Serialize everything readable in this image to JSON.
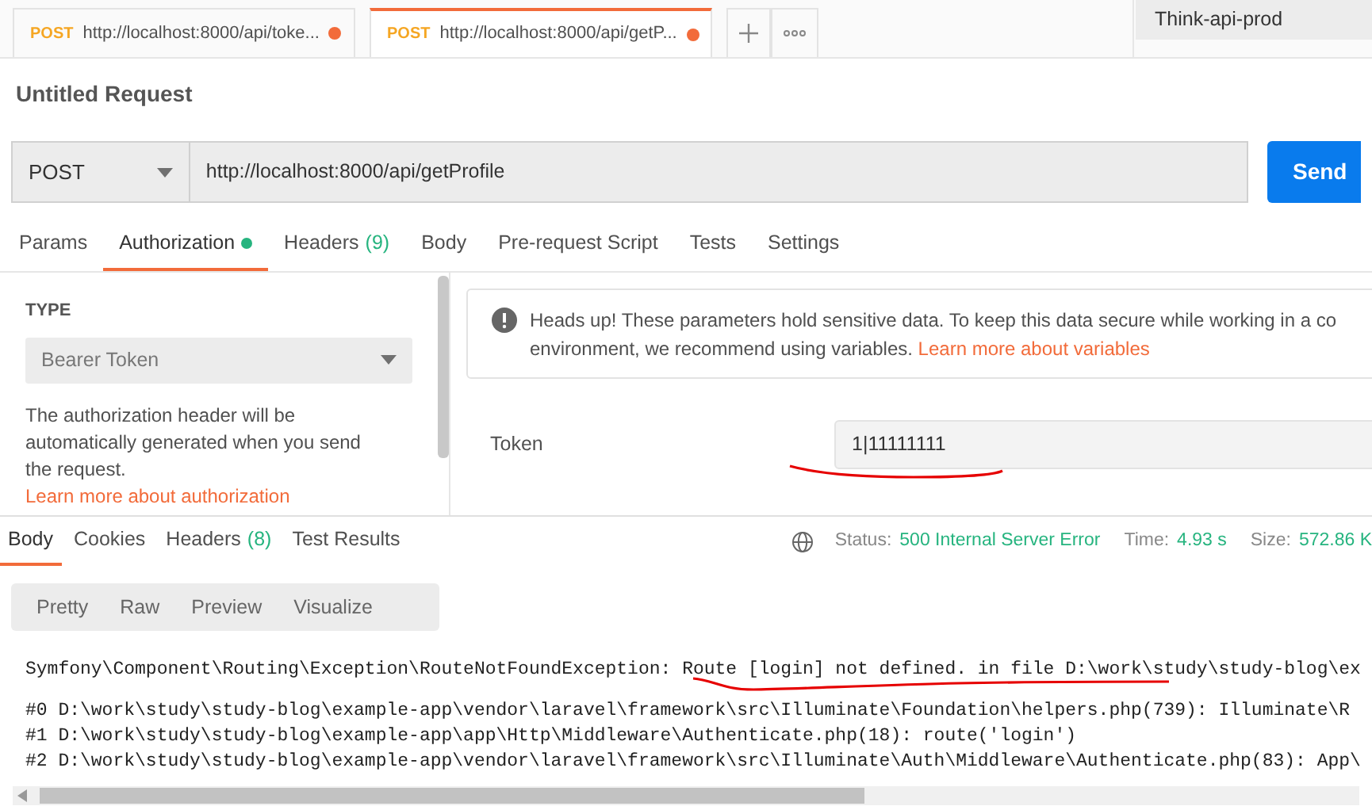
{
  "request_tabs": [
    {
      "method": "POST",
      "url": "http://localhost:8000/api/toke...",
      "unsaved": true,
      "selected": false
    },
    {
      "method": "POST",
      "url": "http://localhost:8000/api/getP...",
      "unsaved": true,
      "selected": true
    }
  ],
  "environment": "Think-api-prod",
  "request_title": "Untitled Request",
  "method": "POST",
  "url": "http://localhost:8000/api/getProfile",
  "send_label": "Send",
  "request_sections": [
    {
      "label": "Params",
      "selected": false
    },
    {
      "label": "Authorization",
      "dot": true,
      "selected": true
    },
    {
      "label": "Headers",
      "count": "(9)",
      "selected": false
    },
    {
      "label": "Body",
      "selected": false
    },
    {
      "label": "Pre-request Script",
      "selected": false
    },
    {
      "label": "Tests",
      "selected": false
    },
    {
      "label": "Settings",
      "selected": false
    }
  ],
  "auth": {
    "type_label": "TYPE",
    "type": "Bearer Token",
    "description": "The authorization header will be automatically generated when you send the request.",
    "learn_link": "Learn more about authorization"
  },
  "notice": {
    "text": "Heads up! These parameters hold sensitive data. To keep this data secure while working in a co environment, we recommend using variables.",
    "link": "Learn more about variables"
  },
  "token": {
    "label": "Token",
    "value": "1|11111111"
  },
  "response_tabs": [
    {
      "label": "Body",
      "selected": true
    },
    {
      "label": "Cookies",
      "selected": false
    },
    {
      "label": "Headers",
      "count": "(8)",
      "selected": false
    },
    {
      "label": "Test Results",
      "selected": false
    }
  ],
  "status": {
    "label": "Status:",
    "value": "500 Internal Server Error"
  },
  "time": {
    "label": "Time:",
    "value": "4.93 s"
  },
  "size": {
    "label": "Size:",
    "value": "572.86 K"
  },
  "view_modes": [
    {
      "label": "Pretty",
      "selected": false
    },
    {
      "label": "Raw",
      "selected": false
    },
    {
      "label": "Preview",
      "selected": false
    },
    {
      "label": "Visualize",
      "selected": false
    }
  ],
  "exception_line": "Symfony\\Component\\Routing\\Exception\\RouteNotFoundException: Route [login] not defined. in file D:\\work\\study\\study-blog\\ex",
  "trace_lines": [
    "#0 D:\\work\\study\\study-blog\\example-app\\vendor\\laravel\\framework\\src\\Illuminate\\Foundation\\helpers.php(739): Illuminate\\R",
    "#1 D:\\work\\study\\study-blog\\example-app\\app\\Http\\Middleware\\Authenticate.php(18): route('login')",
    "#2 D:\\work\\study\\study-blog\\example-app\\vendor\\laravel\\framework\\src\\Illuminate\\Auth\\Middleware\\Authenticate.php(83): App\\"
  ]
}
